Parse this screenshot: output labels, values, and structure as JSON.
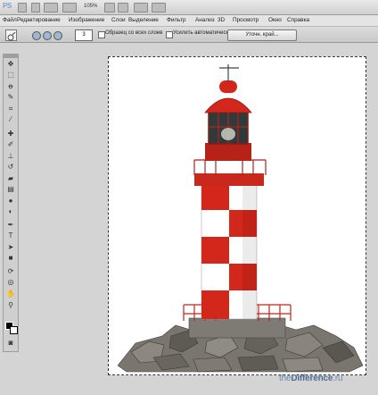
{
  "app": {
    "logo": "PS",
    "zoom": "105%"
  },
  "menu": {
    "items": [
      "Файл",
      "Редактирование",
      "Изображение",
      "Слои",
      "Выделение",
      "Фильтр",
      "Анализ",
      "3D",
      "Просмотр",
      "Окно",
      "Справка"
    ]
  },
  "options": {
    "brush_size": "3",
    "sample_all_layers": "Образец со всех слоев",
    "auto_enhance": "Усилить автоматически",
    "refine_edge": "Уточн. край..."
  },
  "tools": {
    "icons": [
      "move-tool-icon",
      "marquee-tool-icon",
      "lasso-tool-icon",
      "quick-selection-tool-icon",
      "crop-tool-icon",
      "eyedropper-tool-icon",
      "healing-brush-tool-icon",
      "brush-tool-icon",
      "clone-stamp-tool-icon",
      "history-brush-tool-icon",
      "eraser-tool-icon",
      "gradient-tool-icon",
      "blur-tool-icon",
      "dodge-tool-icon",
      "pen-tool-icon",
      "type-tool-icon",
      "path-selection-tool-icon",
      "shape-tool-icon",
      "3d-rotate-tool-icon",
      "3d-orbit-tool-icon",
      "hand-tool-icon",
      "zoom-tool-icon"
    ]
  },
  "colors": {
    "foreground": "#000000",
    "background": "#ffffff",
    "accent": "#d3271c"
  },
  "watermark": {
    "pre": "the",
    "brand": "Difference",
    "post": ".ru"
  }
}
